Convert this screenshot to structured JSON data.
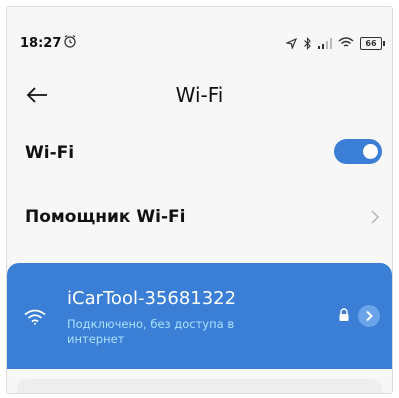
{
  "status_bar": {
    "time": "18:27",
    "battery": "66",
    "icons": [
      "alarm-icon",
      "location-icon",
      "bluetooth-icon",
      "cell-signal-icon",
      "wifi-icon",
      "battery-icon"
    ]
  },
  "header": {
    "title": "Wi-Fi",
    "back_icon": "back-arrow-icon"
  },
  "settings": {
    "wifi_label": "Wi-Fi",
    "wifi_enabled": true,
    "helper_label": "Помощник Wi-Fi"
  },
  "connected_network": {
    "name": "iCarTool-35681322",
    "status": "Подключено, без доступа в интернет",
    "secured": true
  },
  "colors": {
    "accent": "#3a7fd5",
    "status_text": "#a9e1ff",
    "background": "#f7f7f7"
  }
}
